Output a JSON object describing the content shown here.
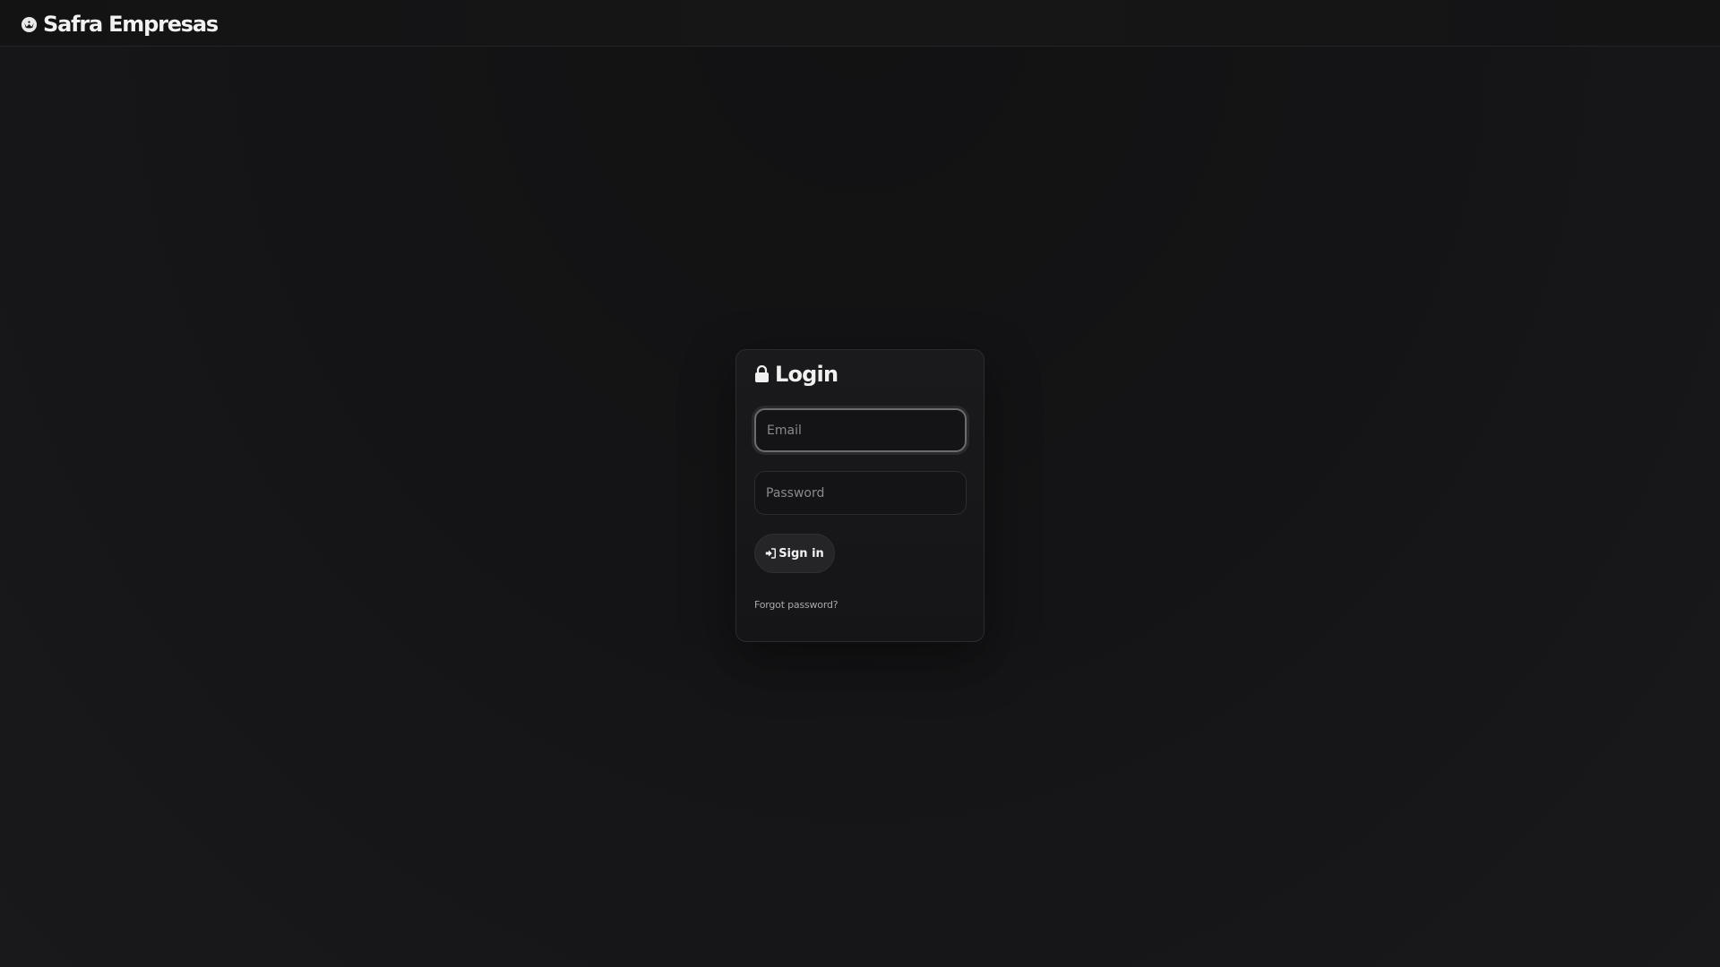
{
  "header": {
    "brand_name": "Safra Empresas",
    "brand_icon": "safra-logo-icon"
  },
  "login": {
    "title": "Login",
    "title_icon": "lock-icon",
    "email_placeholder": "Email",
    "email_value": "",
    "password_placeholder": "Password",
    "password_value": "",
    "signin_label": "Sign in",
    "signin_icon": "sign-in-icon",
    "forgot_label": "Forgot password?"
  },
  "colors": {
    "background": "#141416",
    "card_border": "#2c2c2f",
    "button_bg": "#252528",
    "text_primary": "#f0f0f1",
    "text_muted": "#a9a9ad"
  }
}
